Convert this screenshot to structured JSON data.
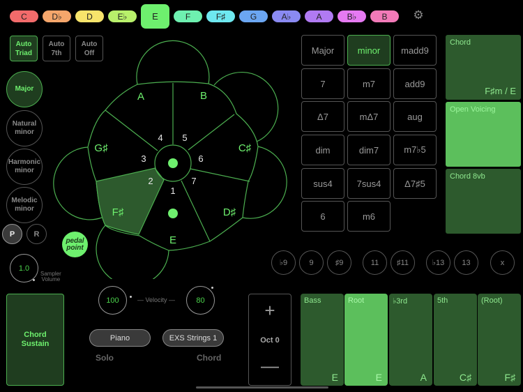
{
  "keys": [
    {
      "label": "C",
      "color": "#f26b6b"
    },
    {
      "label": "D♭",
      "color": "#f5a66b"
    },
    {
      "label": "D",
      "color": "#f7e46b"
    },
    {
      "label": "E♭",
      "color": "#b8f06b"
    },
    {
      "label": "E",
      "color": "#6ef06e",
      "selected": true
    },
    {
      "label": "F",
      "color": "#6ef0b0"
    },
    {
      "label": "F♯",
      "color": "#6ee8f0"
    },
    {
      "label": "G",
      "color": "#6ba6f2"
    },
    {
      "label": "A♭",
      "color": "#8a8af2"
    },
    {
      "label": "A",
      "color": "#b07af2"
    },
    {
      "label": "B♭",
      "color": "#e67af2"
    },
    {
      "label": "B",
      "color": "#f27ab8"
    }
  ],
  "settings_icon": "gear-icon",
  "auto_modes": [
    {
      "line1": "Auto",
      "line2": "Triad",
      "active": true
    },
    {
      "line1": "Auto",
      "line2": "7th",
      "active": false
    },
    {
      "line1": "Auto",
      "line2": "Off",
      "active": false
    }
  ],
  "scales": [
    {
      "line1": "Major",
      "line2": "",
      "active": true
    },
    {
      "line1": "Natural",
      "line2": "minor",
      "active": false
    },
    {
      "line1": "Harmonic",
      "line2": "minor",
      "active": false
    },
    {
      "line1": "Melodic",
      "line2": "minor",
      "active": false
    }
  ],
  "pr_buttons": [
    {
      "label": "P",
      "active": true
    },
    {
      "label": "R",
      "active": false
    }
  ],
  "pedal_point": {
    "line1": "pedal",
    "line2": "point"
  },
  "sampler_volume": {
    "value": "1.0",
    "label_line1": "Sampler",
    "label_line2": "Volume"
  },
  "wheel": {
    "segments": [
      {
        "degree": "1",
        "note": "E"
      },
      {
        "degree": "2",
        "note": "F♯",
        "selected": true
      },
      {
        "degree": "3",
        "note": "G♯"
      },
      {
        "degree": "4",
        "note": "A"
      },
      {
        "degree": "5",
        "note": "B"
      },
      {
        "degree": "6",
        "note": "C♯"
      },
      {
        "degree": "7",
        "note": "D♯"
      }
    ]
  },
  "chord_types": [
    [
      "Major",
      "minor",
      "madd9"
    ],
    [
      "7",
      "m7",
      "add9"
    ],
    [
      "Δ7",
      "mΔ7",
      "aug"
    ],
    [
      "dim",
      "dim7",
      "m7♭5"
    ],
    [
      "sus4",
      "7sus4",
      "Δ7♯5"
    ],
    [
      "6",
      "m6"
    ]
  ],
  "chord_type_selected": "minor",
  "right_panels": {
    "chord": {
      "label": "Chord",
      "value": "F♯m / E"
    },
    "open_voicing": {
      "label": "Open Voicing"
    },
    "chord_8vb": {
      "label": "Chord 8vb"
    }
  },
  "tensions": [
    "♭9",
    "9",
    "♯9",
    "11",
    "♯11",
    "♭13",
    "13",
    "x"
  ],
  "chord_sustain": {
    "line1": "Chord",
    "line2": "Sustain"
  },
  "velocity": {
    "solo": "100",
    "chord": "80",
    "label": "— Velocity —"
  },
  "instruments": {
    "solo": "Piano",
    "chord": "EXS Strings 1",
    "solo_label": "Solo",
    "chord_label": "Chord"
  },
  "octave": {
    "plus": "+",
    "label": "Oct 0",
    "minus": "—"
  },
  "voices": [
    {
      "label": "Bass",
      "note": "E",
      "active": false
    },
    {
      "label": "Root",
      "note": "E",
      "active": true
    },
    {
      "label": "♭3rd",
      "note": "A",
      "active": false
    },
    {
      "label": "5th",
      "note": "C♯",
      "active": false
    },
    {
      "label": "(Root)",
      "note": "F♯",
      "active": false
    }
  ]
}
